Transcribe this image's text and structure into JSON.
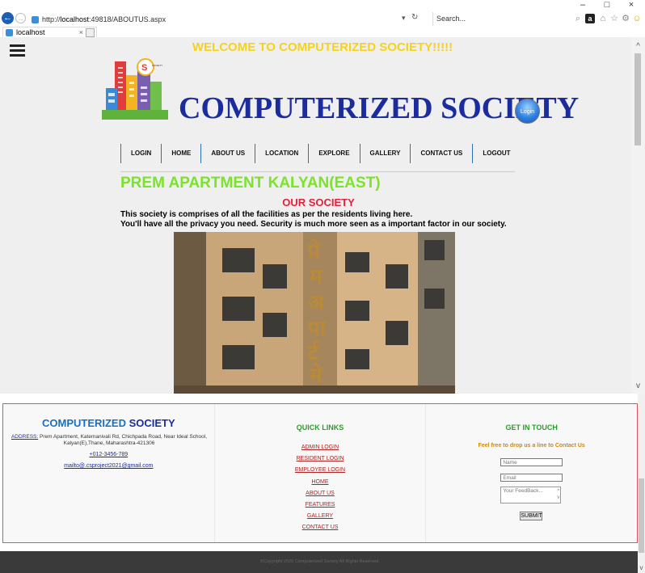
{
  "browser": {
    "url_prefix": "http://",
    "url_host": "localhost",
    "url_rest": ":49818/ABOUTUS.aspx",
    "search_placeholder": "Search...",
    "tab_title": "localhost",
    "minimize": "–",
    "maximize": "□",
    "close": "×"
  },
  "header": {
    "welcome": "WELCOME TO COMPUTERIZED SOCIETY!!!!!",
    "brand": "COMPUTERIZED SOCIETY",
    "login_button": "Login"
  },
  "nav": {
    "items": [
      "LOGIN",
      "HOME",
      "ABOUT US",
      "LOCATION",
      "EXPLORE",
      "GALLERY",
      "CONTACT US",
      "LOGOUT"
    ]
  },
  "main": {
    "apartment_title": "PREM APARTMENT KALYAN(EAST)",
    "section_title": "OUR SOCIETY",
    "line1": "This society is comprises of all the facilities as per the residents living here.",
    "line2": "You'll have all the privacy you need. Security is much more seen as a important factor in our society."
  },
  "footer": {
    "brand_a": "COMPUTERIZED",
    "brand_b": " SOCIETY",
    "address_label": "ADDRESS:",
    "address_text": " Prem Apartment, Katemanivali Rd, Chichpada Road, Near Ideal School, Kalyan(E),Thane, Maharashtra-421306",
    "phone": "+012-3456-789",
    "email": "mailto@.csproject2021@gmail.com",
    "quick_links_title": "QUICK LINKS",
    "quick_links": [
      "ADMIN LOGIN",
      "RESIDENT LOGIN",
      "EMPLOYEE LOGIN",
      "HOME",
      "ABOUT US",
      "FEATURES",
      "GALLERY",
      "CONTACT US"
    ],
    "touch_title": "GET IN TOUCH",
    "touch_sub": "Feel free to drop us a line to Contact Us",
    "name_placeholder": "Name",
    "email_placeholder": "Email",
    "feedback_placeholder": "Your FeedBack...",
    "submit": "SUBMIT",
    "copyright": "©Copyright 2020 Computerized Society All Rights Reserved"
  },
  "colors": {
    "welcome": "#f5d31b",
    "brand": "#1b2c9f",
    "apartment_title": "#7be32a",
    "section_title": "#e6203b",
    "nav_accent": "#1a75c8"
  }
}
